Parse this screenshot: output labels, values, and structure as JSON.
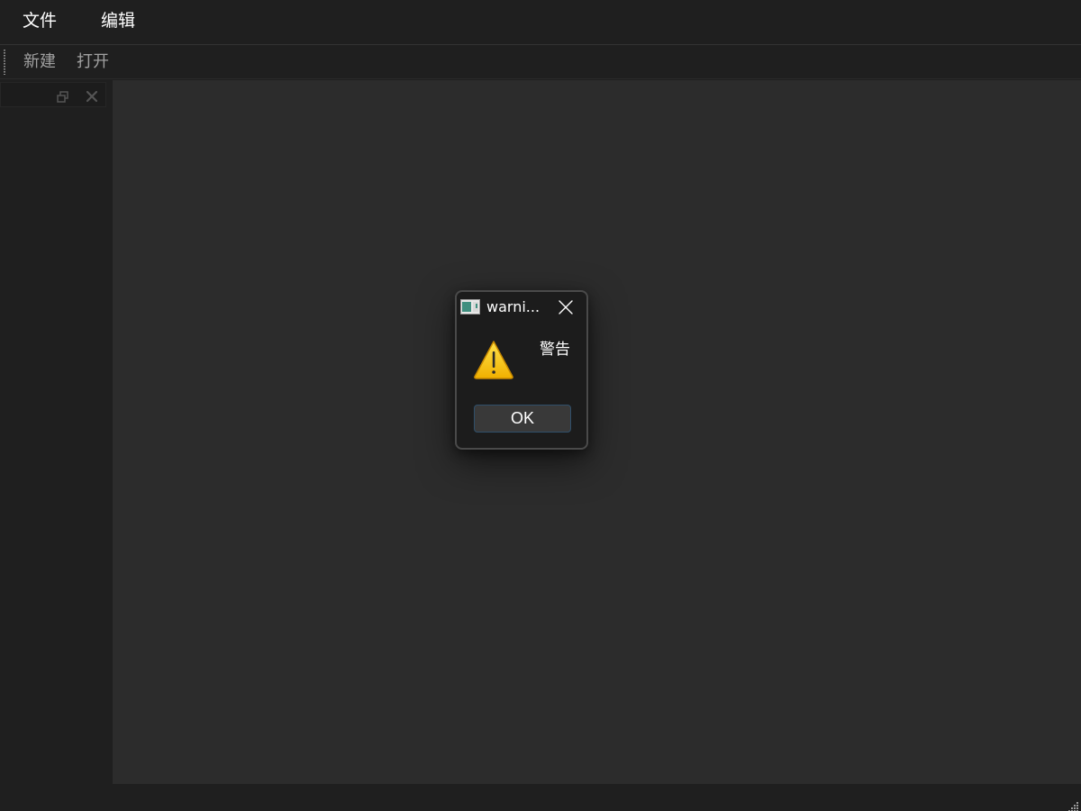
{
  "menubar": {
    "items": [
      {
        "label": "文件"
      },
      {
        "label": "编辑"
      }
    ]
  },
  "toolbar": {
    "new_label": "新建",
    "open_label": "打开"
  },
  "dock": {
    "float_icon": "float-icon",
    "close_icon": "close-icon"
  },
  "dialog": {
    "title": "warni...",
    "message": "警告",
    "ok_label": "OK",
    "icon": "warning-icon",
    "app_icon": "app-icon"
  },
  "colors": {
    "background": "#1f1f1f",
    "central": "#2c2c2c",
    "dialog_bg": "#1c1c1c",
    "dialog_border": "#4a4a4a",
    "button_bg": "#393939",
    "button_border": "#2f4f6a",
    "warning_yellow": "#f5c400"
  }
}
